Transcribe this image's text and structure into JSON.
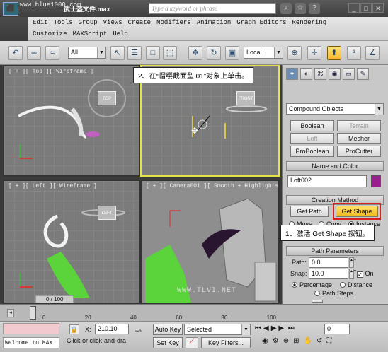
{
  "titlebar": {
    "watermark": "www.blue1000.com",
    "file_title": "武士盔文件.max",
    "search_placeholder": "Type a keyword or phrase"
  },
  "menu": {
    "row1": [
      "Edit",
      "Tools",
      "Group",
      "Views",
      "Create",
      "Modifiers",
      "Animation",
      "Graph Editors",
      "Rendering"
    ],
    "row2": [
      "Customize",
      "MAXScript",
      "Help"
    ]
  },
  "toolbar": {
    "selection_filter": "All",
    "ref_coord": "Local"
  },
  "viewports": {
    "top": {
      "label": "[ + ][ Top ][ Wireframe ]",
      "cube": "TOP"
    },
    "front": {
      "label": "",
      "cube": "FRONT"
    },
    "left": {
      "label": "[ + ][ Left ][ Wireframe ]",
      "cube": "LEFT"
    },
    "camera": {
      "label": "[ + ][ Camera001 ][ Smooth + Highlights ]"
    }
  },
  "callouts": {
    "step2": "2、在“帽缨截面型 01”对象上单击。",
    "step1": "1、激活 Get Shape 按钮。"
  },
  "command_panel": {
    "category": "Compound Objects",
    "object_types": [
      "Boolean",
      "Terrain",
      "Loft",
      "Mesher",
      "ProBoolean",
      "ProCutter"
    ],
    "name_color_title": "Name and Color",
    "object_name": "Loft002",
    "object_color": "#9b1f8a",
    "creation_method_title": "Creation Method",
    "get_path": "Get Path",
    "get_shape": "Get Shape",
    "move_options": [
      "Move",
      "Copy",
      "Instance"
    ],
    "path_params_title": "Path Parameters",
    "path_label": "Path:",
    "path_value": "0.0",
    "snap_label": "Snap:",
    "snap_value": "10.0",
    "on_label": "On",
    "percentage": "Percentage",
    "distance": "Distance",
    "path_steps": "Path Steps"
  },
  "timeline": {
    "frame_readout": "0 / 100",
    "ticks": [
      "0",
      "20",
      "40",
      "60",
      "80",
      "100"
    ]
  },
  "statusbar": {
    "status_text": "Welcome to MAX",
    "prompt": "Click or click-and-dra",
    "x_label": "X:",
    "x_value": "210.10",
    "auto_key": "Auto Key",
    "set_key": "Set Key",
    "key_mode": "Selected",
    "key_filters": "Key Filters...",
    "frame": "0"
  },
  "watermark_bottom": "WWW.TLVI.NET"
}
